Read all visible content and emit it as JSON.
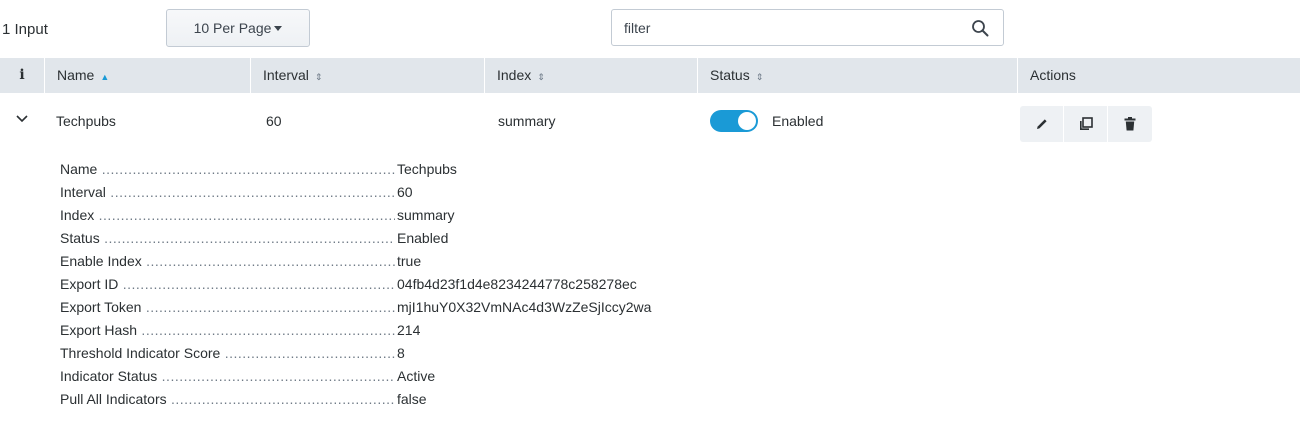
{
  "toolbar": {
    "count_label": "1 Input",
    "per_page_label": "10 Per Page",
    "filter_placeholder": "filter"
  },
  "table": {
    "headers": {
      "info": "i",
      "name": "Name",
      "interval": "Interval",
      "index": "Index",
      "status": "Status",
      "actions": "Actions"
    },
    "sort": {
      "name": "▲",
      "interval": "⇕",
      "index": "⇕",
      "status": "⇕"
    },
    "rows": [
      {
        "name": "Techpubs",
        "interval": "60",
        "index": "summary",
        "status": "Enabled",
        "enabled": true
      }
    ]
  },
  "details": [
    {
      "label": "Name",
      "value": "Techpubs"
    },
    {
      "label": "Interval",
      "value": "60"
    },
    {
      "label": "Index",
      "value": "summary"
    },
    {
      "label": "Status",
      "value": "Enabled"
    },
    {
      "label": "Enable Index",
      "value": "true"
    },
    {
      "label": "Export ID",
      "value": "04fb4d23f1d4e8234244778c258278ec"
    },
    {
      "label": "Export Token",
      "value": "mjI1huY0X32VmNAc4d3WzZeSjIccy2wa"
    },
    {
      "label": "Export Hash",
      "value": "214"
    },
    {
      "label": "Threshold Indicator Score",
      "value": "8"
    },
    {
      "label": "Indicator Status",
      "value": "Active"
    },
    {
      "label": "Pull All Indicators",
      "value": "false"
    }
  ],
  "icons": {
    "search": "search-icon",
    "expand": "chevron-down-icon",
    "edit": "pencil-icon",
    "clone": "clone-icon",
    "delete": "trash-icon"
  },
  "colors": {
    "accent": "#1a9ad6",
    "header_bg": "#e1e6eb"
  }
}
